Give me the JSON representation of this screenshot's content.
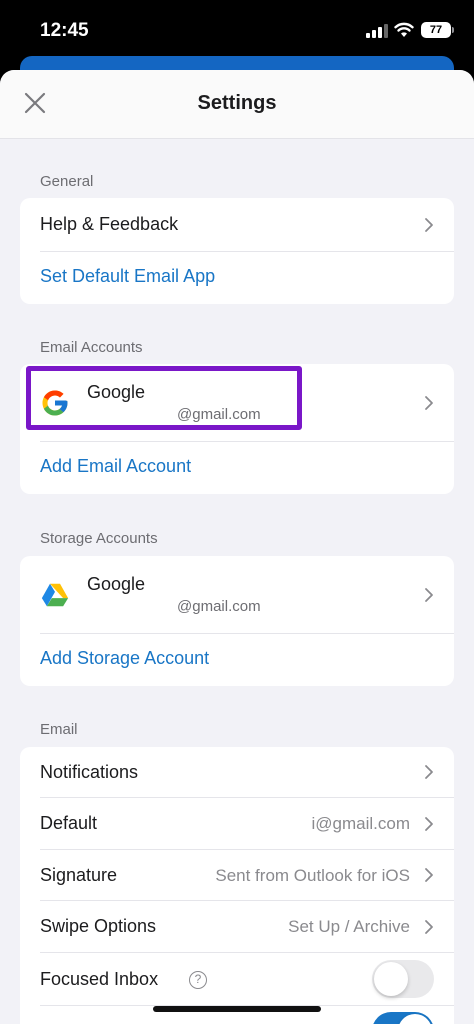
{
  "status_bar": {
    "time": "12:45",
    "battery": "77"
  },
  "header": {
    "title": "Settings"
  },
  "general": {
    "label": "General",
    "help_feedback": "Help & Feedback",
    "set_default_email_app": "Set Default Email App"
  },
  "email_accounts": {
    "label": "Email Accounts",
    "account": {
      "name": "Google",
      "email": "@gmail.com"
    },
    "add_account": "Add Email Account"
  },
  "storage_accounts": {
    "label": "Storage Accounts",
    "account": {
      "name": "Google",
      "email": "@gmail.com"
    },
    "add_account": "Add Storage Account"
  },
  "email": {
    "label": "Email",
    "notifications": "Notifications",
    "default": {
      "label": "Default",
      "value": "i@gmail.com"
    },
    "signature": {
      "label": "Signature",
      "value": "Sent from Outlook for iOS"
    },
    "swipe_options": {
      "label": "Swipe Options",
      "value": "Set Up / Archive"
    },
    "focused_inbox": {
      "label": "Focused Inbox",
      "help_glyph": "?",
      "enabled": false
    },
    "organize_by_thread": {
      "enabled": true
    }
  },
  "colors": {
    "accent": "#1976c6",
    "highlight": "#7a17c8",
    "background": "#f2f2f7"
  },
  "icons": {
    "close": "close-icon",
    "chevron": "chevron-right-icon",
    "google": "google-icon",
    "drive": "google-drive-icon",
    "help": "help-circle-icon"
  }
}
